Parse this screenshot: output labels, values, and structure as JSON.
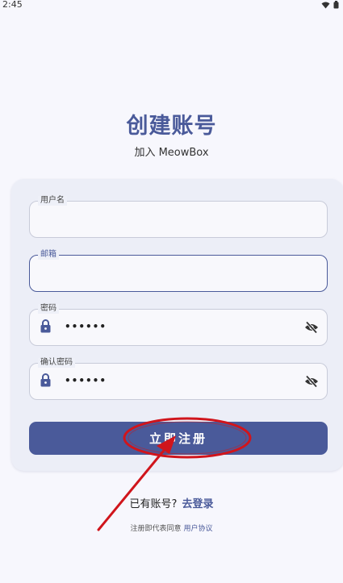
{
  "status_bar": {
    "time": "2:45",
    "icons": [
      "wifi-icon",
      "battery-icon"
    ]
  },
  "header": {
    "title": "创建账号",
    "subtitle": "加入 MeowBox"
  },
  "form": {
    "username": {
      "label": "用户名",
      "value": ""
    },
    "email": {
      "label": "邮箱",
      "value": ""
    },
    "password": {
      "label": "密码",
      "value": "••••••",
      "icon": "lock-icon",
      "toggle_icon": "eye-off-icon"
    },
    "confirm_password": {
      "label": "确认密码",
      "value": "••••••",
      "icon": "lock-icon",
      "toggle_icon": "eye-off-icon"
    },
    "submit_label": "立即注册"
  },
  "footer": {
    "login_prompt": "已有账号?",
    "login_link": "去登录",
    "agree_text": "注册即代表同意",
    "agree_link": "用户协议"
  },
  "colors": {
    "accent": "#4a5a9a",
    "annotation": "#d0151c"
  }
}
